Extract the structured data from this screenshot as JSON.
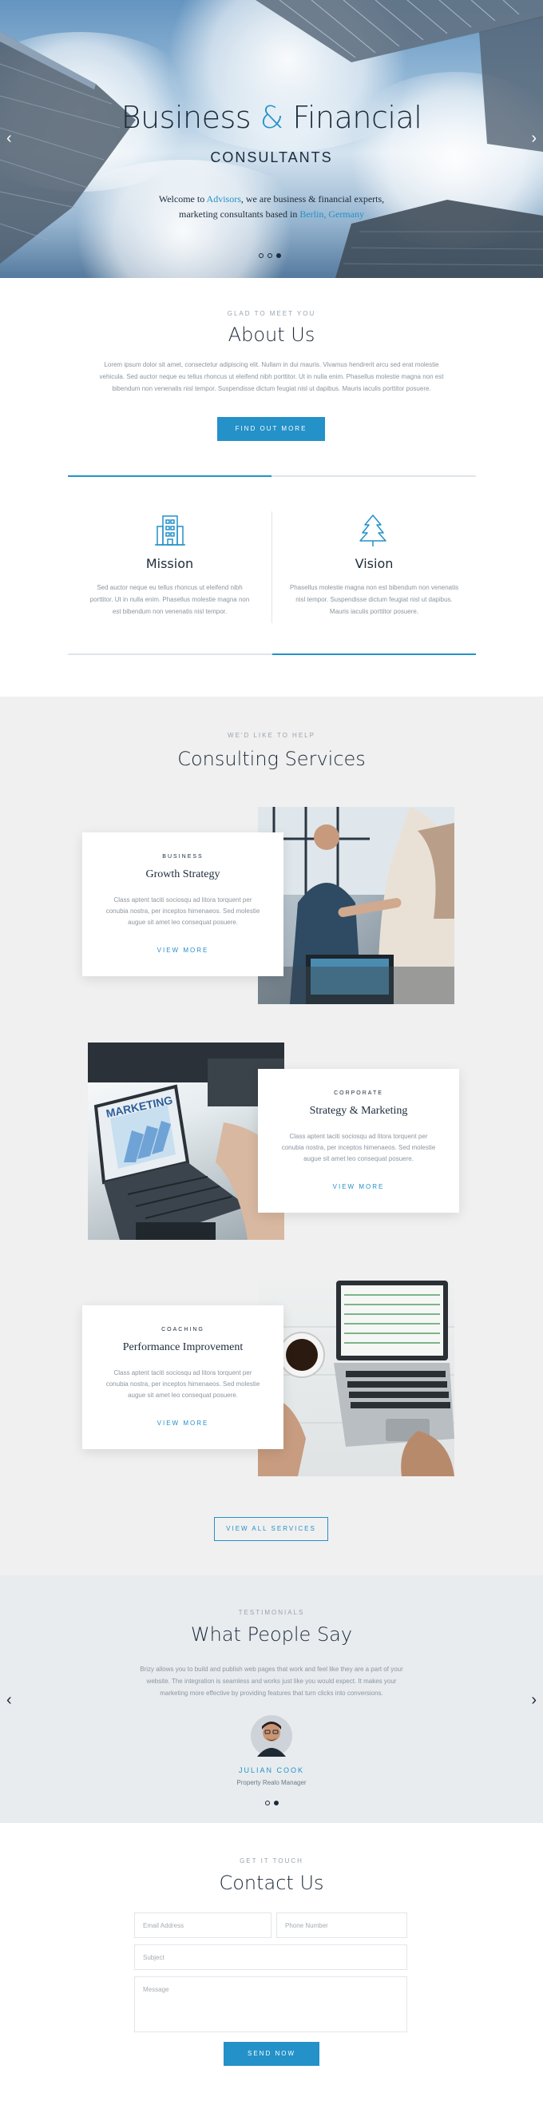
{
  "hero": {
    "title_part1": "Business",
    "title_amp": "&",
    "title_part2": "Financial",
    "subtitle": "CONSULTANTS",
    "desc_line1_prefix": "Welcome to ",
    "desc_line1_brand": "Advisors",
    "desc_line1_suffix": ", we are business & financial experts,",
    "desc_line2_prefix": "marketing consultants based in ",
    "desc_line2_location": "Berlin, Germany",
    "prev_arrow": "‹",
    "next_arrow": "›",
    "slide_count": 3,
    "active_slide": 3
  },
  "about": {
    "eyebrow": "GLAD TO MEET YOU",
    "title": "About Us",
    "text_line1": "Lorem ipsum dolor sit amet, consectetur adipiscing elit. Nullam in dui mauris. Vivamus hendrerit arcu sed erat molestie",
    "text_line2": "vehicula. Sed auctor neque eu tellus rhoncus ut eleifend nibh porttitor. Ut in nulla enim. Phasellus molestie magna non est",
    "text_line3": "bibendum non venenatis nisl tempor. Suspendisse dictum feugiat nisl ut dapibus. Mauris iaculis porttitor posuere.",
    "button": "FIND OUT MORE",
    "mission": {
      "title": "Mission",
      "line1": "Sed auctor neque eu tellus rhoncus ut eleifend nibh",
      "line2": "porttitor. Ut in nulla enim. Phasellus molestie magna non",
      "line3": "est bibendum non venenatis nisl tempor."
    },
    "vision": {
      "title": "Vision",
      "line1": "Phasellus molestie magna non est bibendum non venenatis",
      "line2": "nisl tempor. Suspendisse dictum feugiat nisl ut dapibus.",
      "line3": "Mauris iaculis porttitor posuere."
    }
  },
  "services": {
    "eyebrow": "WE'D LIKE TO HELP",
    "title": "Consulting Services",
    "items": [
      {
        "category": "BUSINESS",
        "title": "Growth Strategy",
        "line1": "Class aptent taciti sociosqu ad litora torquent per",
        "line2": "conubia nostra, per inceptos himenaeos. Sed molestie",
        "line3": "augue sit amet leo consequat posuere.",
        "link": "VIEW MORE"
      },
      {
        "category": "CORPORATE",
        "title": "Strategy & Marketing",
        "line1": "Class aptent taciti sociosqu ad litora torquent per",
        "line2": "conubia nostra, per inceptos himenaeos. Sed molestie",
        "line3": "augue sit amet leo consequat posuere.",
        "link": "VIEW MORE"
      },
      {
        "category": "COACHING",
        "title": "Performance Improvement",
        "line1": "Class aptent taciti sociosqu ad litora torquent per",
        "line2": "conubia nostra, per inceptos himenaeos. Sed molestie",
        "line3": "augue sit amet leo consequat posuere.",
        "link": "VIEW MORE"
      }
    ],
    "laptop_screen_text": "MARKETING",
    "view_all": "VIEW ALL SERVICES"
  },
  "testimonials": {
    "eyebrow": "TESTIMONIALS",
    "title": "What People Say",
    "line1": "Brizy allows you to build and publish web pages that work and feel like they are a part of your",
    "line2": "website. The integration is seamless and works just like you would expect. It makes your",
    "line3": "marketing more effective by providing features that turn clicks into conversions.",
    "name": "JULIAN COOK",
    "role": "Property Realo Manager",
    "prev_arrow": "‹",
    "next_arrow": "›",
    "slide_count": 2,
    "active_slide": 2
  },
  "contact": {
    "eyebrow": "GET IT TOUCH",
    "title": "Contact Us",
    "email_placeholder": "Email Address",
    "phone_placeholder": "Phone Number",
    "subject_placeholder": "Subject",
    "message_placeholder": "Message",
    "button": "SEND NOW"
  },
  "colors": {
    "accent": "#2491c8",
    "heading": "#1c2a3a",
    "muted_text": "#8c96a0",
    "services_bg": "#f0f0f0",
    "testimonials_bg": "#e8ecef"
  }
}
